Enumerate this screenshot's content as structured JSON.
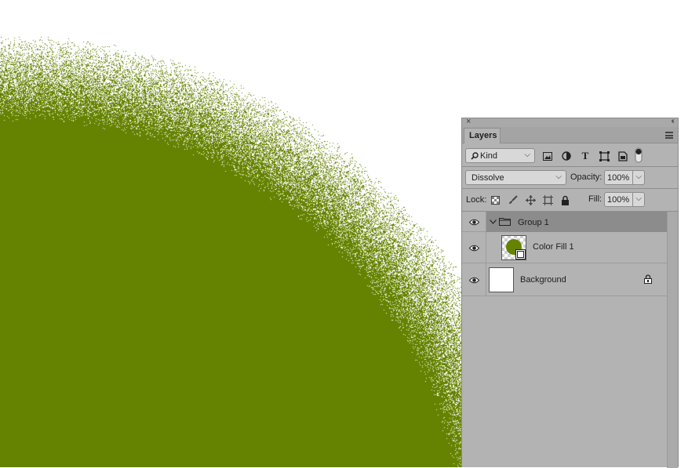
{
  "canvas": {
    "fill_color": "#658200",
    "background": "#ffffff"
  },
  "panel": {
    "title": "Layers",
    "filter": {
      "label": "Kind",
      "icons": [
        "image-filter-icon",
        "adjustment-filter-icon",
        "type-filter-icon",
        "shape-filter-icon",
        "smart-object-filter-icon",
        "filter-toggle-icon"
      ],
      "type_glyph": "T"
    },
    "blend_mode": "Dissolve",
    "opacity": {
      "label": "Opacity:",
      "value": "100%"
    },
    "lock": {
      "label": "Lock:",
      "icons": [
        "lock-transparency-icon",
        "lock-pixels-icon",
        "lock-position-icon",
        "lock-artboard-icon",
        "lock-all-icon"
      ]
    },
    "fill": {
      "label": "Fill:",
      "value": "100%"
    },
    "layers": [
      {
        "name": "Group 1",
        "type": "group",
        "visible": true,
        "selected": true,
        "expanded": true
      },
      {
        "name": "Color Fill 1",
        "type": "fill",
        "visible": true,
        "selected": false,
        "swatch": "#658200"
      },
      {
        "name": "Background",
        "type": "background",
        "visible": true,
        "selected": false,
        "locked": true
      }
    ]
  }
}
